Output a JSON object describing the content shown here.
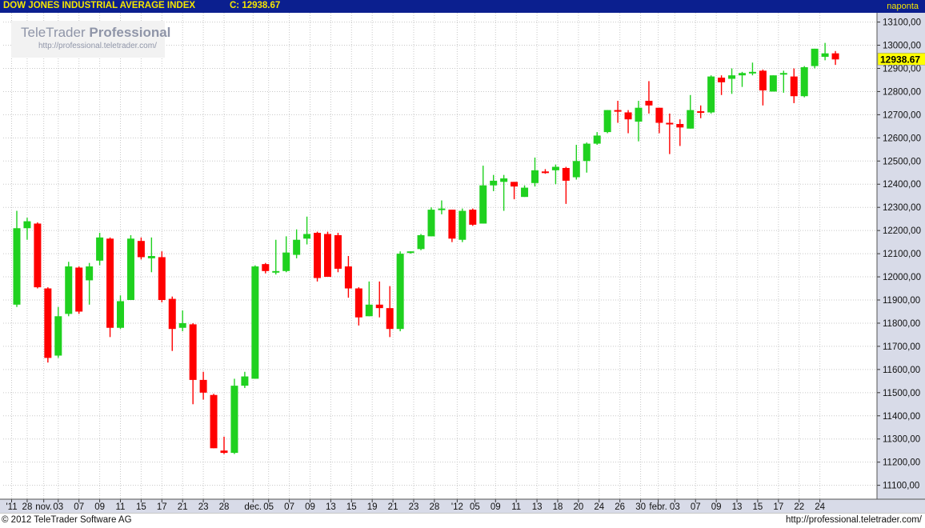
{
  "header": {
    "title": "DOW JONES INDUSTRIAL AVERAGE INDEX",
    "close_label": "C: 12938.67",
    "interval": "naponta"
  },
  "watermark": {
    "brand_part1": "TeleTrader",
    "brand_part2": "Professional",
    "url": "http://professional.teletrader.com/"
  },
  "footer": {
    "copyright": "© 2012 TeleTrader Software AG",
    "url": "http://professional.teletrader.com/"
  },
  "colors": {
    "up": "#1fd11f",
    "down": "#ff0000",
    "header_bg": "#0b1f8f",
    "header_text": "#f5e600",
    "last_price_bg": "#ffff00",
    "grid": "#c8c8c8",
    "axis_band": "#d8dbe8"
  },
  "chart_data": {
    "type": "candlestick",
    "last_price_label": "12938.67",
    "ylim": [
      11040,
      13140
    ],
    "y_ticks": [
      11100,
      11200,
      11300,
      11400,
      11500,
      11600,
      11700,
      11800,
      11900,
      12000,
      12100,
      12200,
      12300,
      12400,
      12500,
      12600,
      12700,
      12800,
      12900,
      13000,
      13100
    ],
    "y_tick_labels": [
      "11100,00",
      "11200,00",
      "11300,00",
      "11400,00",
      "11500,00",
      "11600,00",
      "11700,00",
      "11800,00",
      "11900,00",
      "12000,00",
      "12100,00",
      "12200,00",
      "12300,00",
      "12400,00",
      "12500,00",
      "12600,00",
      "12700,00",
      "12800,00",
      "12900,00",
      "13000,00",
      "13100,00"
    ],
    "x_tick_labels": [
      {
        "i": -0.5,
        "label": "'11"
      },
      {
        "i": 1,
        "label": "28"
      },
      {
        "i": 2.6,
        "label": "nov."
      },
      {
        "i": 4,
        "label": "03"
      },
      {
        "i": 6,
        "label": "07"
      },
      {
        "i": 8,
        "label": "09"
      },
      {
        "i": 10,
        "label": "11"
      },
      {
        "i": 12,
        "label": "15"
      },
      {
        "i": 14,
        "label": "17"
      },
      {
        "i": 16,
        "label": "21"
      },
      {
        "i": 18,
        "label": "23"
      },
      {
        "i": 20,
        "label": "28"
      },
      {
        "i": 22.8,
        "label": "dec."
      },
      {
        "i": 24.3,
        "label": "05"
      },
      {
        "i": 26.3,
        "label": "07"
      },
      {
        "i": 28.3,
        "label": "09"
      },
      {
        "i": 30.3,
        "label": "13"
      },
      {
        "i": 32.3,
        "label": "15"
      },
      {
        "i": 34.3,
        "label": "19"
      },
      {
        "i": 36.3,
        "label": "21"
      },
      {
        "i": 38.3,
        "label": "23"
      },
      {
        "i": 40.3,
        "label": "28"
      },
      {
        "i": 42.5,
        "label": "'12"
      },
      {
        "i": 44.2,
        "label": "05"
      },
      {
        "i": 46.2,
        "label": "09"
      },
      {
        "i": 48.2,
        "label": "11"
      },
      {
        "i": 50.2,
        "label": "13"
      },
      {
        "i": 52.2,
        "label": "18"
      },
      {
        "i": 54.2,
        "label": "20"
      },
      {
        "i": 56.2,
        "label": "24"
      },
      {
        "i": 58.2,
        "label": "26"
      },
      {
        "i": 60.2,
        "label": "30"
      },
      {
        "i": 61.9,
        "label": "febr."
      },
      {
        "i": 63.5,
        "label": "03"
      },
      {
        "i": 65.5,
        "label": "07"
      },
      {
        "i": 67.5,
        "label": "09"
      },
      {
        "i": 69.5,
        "label": "13"
      },
      {
        "i": 71.5,
        "label": "15"
      },
      {
        "i": 73.5,
        "label": "17"
      },
      {
        "i": 75.5,
        "label": "22"
      },
      {
        "i": 77.5,
        "label": "24"
      }
    ],
    "candles": [
      {
        "o": 11880,
        "h": 12285,
        "l": 11870,
        "c": 12210
      },
      {
        "o": 12210,
        "h": 12255,
        "l": 12160,
        "c": 12240
      },
      {
        "o": 12230,
        "h": 12235,
        "l": 11950,
        "c": 11955
      },
      {
        "o": 11950,
        "h": 11955,
        "l": 11630,
        "c": 11650
      },
      {
        "o": 11660,
        "h": 11870,
        "l": 11650,
        "c": 11830
      },
      {
        "o": 11840,
        "h": 12065,
        "l": 11830,
        "c": 12045
      },
      {
        "o": 12040,
        "h": 12045,
        "l": 11840,
        "c": 11850
      },
      {
        "o": 11985,
        "h": 12060,
        "l": 11880,
        "c": 12045
      },
      {
        "o": 12070,
        "h": 12190,
        "l": 12050,
        "c": 12170
      },
      {
        "o": 12165,
        "h": 12170,
        "l": 11740,
        "c": 11780
      },
      {
        "o": 11780,
        "h": 11920,
        "l": 11775,
        "c": 11895
      },
      {
        "o": 11900,
        "h": 12180,
        "l": 11900,
        "c": 12165
      },
      {
        "o": 12155,
        "h": 12170,
        "l": 12075,
        "c": 12085
      },
      {
        "o": 12080,
        "h": 12170,
        "l": 12020,
        "c": 12090
      },
      {
        "o": 12085,
        "h": 12110,
        "l": 11890,
        "c": 11900
      },
      {
        "o": 11905,
        "h": 11915,
        "l": 11680,
        "c": 11775
      },
      {
        "o": 11780,
        "h": 11855,
        "l": 11765,
        "c": 11800
      },
      {
        "o": 11795,
        "h": 11800,
        "l": 11450,
        "c": 11555
      },
      {
        "o": 11555,
        "h": 11590,
        "l": 11470,
        "c": 11500
      },
      {
        "o": 11490,
        "h": 11495,
        "l": 11260,
        "c": 11260
      },
      {
        "o": 11250,
        "h": 11310,
        "l": 11235,
        "c": 11240
      },
      {
        "o": 11240,
        "h": 11560,
        "l": 11235,
        "c": 11530
      },
      {
        "o": 11530,
        "h": 11590,
        "l": 11520,
        "c": 11570
      },
      {
        "o": 11560,
        "h": 12050,
        "l": 11560,
        "c": 12045
      },
      {
        "o": 12055,
        "h": 12060,
        "l": 12015,
        "c": 12025
      },
      {
        "o": 12020,
        "h": 12160,
        "l": 12010,
        "c": 12025
      },
      {
        "o": 12025,
        "h": 12175,
        "l": 12020,
        "c": 12105
      },
      {
        "o": 12095,
        "h": 12205,
        "l": 12080,
        "c": 12160
      },
      {
        "o": 12165,
        "h": 12260,
        "l": 12140,
        "c": 12185
      },
      {
        "o": 12190,
        "h": 12195,
        "l": 11980,
        "c": 11995
      },
      {
        "o": 12185,
        "h": 12195,
        "l": 12005,
        "c": 12000
      },
      {
        "o": 12180,
        "h": 12190,
        "l": 12020,
        "c": 12035
      },
      {
        "o": 12045,
        "h": 12090,
        "l": 11910,
        "c": 11950
      },
      {
        "o": 11950,
        "h": 11955,
        "l": 11790,
        "c": 11825
      },
      {
        "o": 11830,
        "h": 11980,
        "l": 11830,
        "c": 11880
      },
      {
        "o": 11880,
        "h": 11980,
        "l": 11825,
        "c": 11865
      },
      {
        "o": 11865,
        "h": 11960,
        "l": 11740,
        "c": 11775
      },
      {
        "o": 11775,
        "h": 12110,
        "l": 11765,
        "c": 12100
      },
      {
        "o": 12105,
        "h": 12110,
        "l": 12100,
        "c": 12110
      },
      {
        "o": 12120,
        "h": 12185,
        "l": 12115,
        "c": 12180
      },
      {
        "o": 12175,
        "h": 12300,
        "l": 12175,
        "c": 12290
      },
      {
        "o": 12290,
        "h": 12330,
        "l": 12270,
        "c": 12295
      },
      {
        "o": 12290,
        "h": 12290,
        "l": 12150,
        "c": 12165
      },
      {
        "o": 12160,
        "h": 12295,
        "l": 12150,
        "c": 12285
      },
      {
        "o": 12290,
        "h": 12295,
        "l": 12220,
        "c": 12225
      },
      {
        "o": 12230,
        "h": 12480,
        "l": 12230,
        "c": 12395
      },
      {
        "o": 12395,
        "h": 12440,
        "l": 12370,
        "c": 12415
      },
      {
        "o": 12410,
        "h": 12440,
        "l": 12285,
        "c": 12425
      },
      {
        "o": 12410,
        "h": 12410,
        "l": 12335,
        "c": 12390
      },
      {
        "o": 12345,
        "h": 12395,
        "l": 12345,
        "c": 12385
      },
      {
        "o": 12405,
        "h": 12515,
        "l": 12390,
        "c": 12460
      },
      {
        "o": 12455,
        "h": 12465,
        "l": 12445,
        "c": 12450
      },
      {
        "o": 12460,
        "h": 12485,
        "l": 12400,
        "c": 12475
      },
      {
        "o": 12470,
        "h": 12475,
        "l": 12315,
        "c": 12415
      },
      {
        "o": 12430,
        "h": 12570,
        "l": 12420,
        "c": 12500
      },
      {
        "o": 12500,
        "h": 12580,
        "l": 12450,
        "c": 12575
      },
      {
        "o": 12575,
        "h": 12625,
        "l": 12570,
        "c": 12610
      },
      {
        "o": 12625,
        "h": 12720,
        "l": 12620,
        "c": 12720
      },
      {
        "o": 12720,
        "h": 12760,
        "l": 12665,
        "c": 12715
      },
      {
        "o": 12710,
        "h": 12720,
        "l": 12620,
        "c": 12680
      },
      {
        "o": 12670,
        "h": 12760,
        "l": 12585,
        "c": 12730
      },
      {
        "o": 12760,
        "h": 12845,
        "l": 12705,
        "c": 12740
      },
      {
        "o": 12730,
        "h": 12730,
        "l": 12620,
        "c": 12665
      },
      {
        "o": 12665,
        "h": 12705,
        "l": 12530,
        "c": 12660
      },
      {
        "o": 12660,
        "h": 12680,
        "l": 12565,
        "c": 12645
      },
      {
        "o": 12640,
        "h": 12785,
        "l": 12640,
        "c": 12720
      },
      {
        "o": 12715,
        "h": 12740,
        "l": 12685,
        "c": 12710
      },
      {
        "o": 12710,
        "h": 12870,
        "l": 12705,
        "c": 12865
      },
      {
        "o": 12860,
        "h": 12870,
        "l": 12785,
        "c": 12840
      },
      {
        "o": 12855,
        "h": 12900,
        "l": 12790,
        "c": 12870
      },
      {
        "o": 12870,
        "h": 12885,
        "l": 12820,
        "c": 12880
      },
      {
        "o": 12880,
        "h": 12925,
        "l": 12870,
        "c": 12885
      },
      {
        "o": 12890,
        "h": 12895,
        "l": 12740,
        "c": 12805
      },
      {
        "o": 12800,
        "h": 12870,
        "l": 12800,
        "c": 12870
      },
      {
        "o": 12875,
        "h": 12890,
        "l": 12795,
        "c": 12880
      },
      {
        "o": 12865,
        "h": 12900,
        "l": 12750,
        "c": 12780
      },
      {
        "o": 12780,
        "h": 12910,
        "l": 12775,
        "c": 12905
      },
      {
        "o": 12910,
        "h": 12985,
        "l": 12900,
        "c": 12985
      },
      {
        "o": 12950,
        "h": 13010,
        "l": 12935,
        "c": 12965
      },
      {
        "o": 12965,
        "h": 12975,
        "l": 12915,
        "c": 12938.67
      }
    ]
  }
}
